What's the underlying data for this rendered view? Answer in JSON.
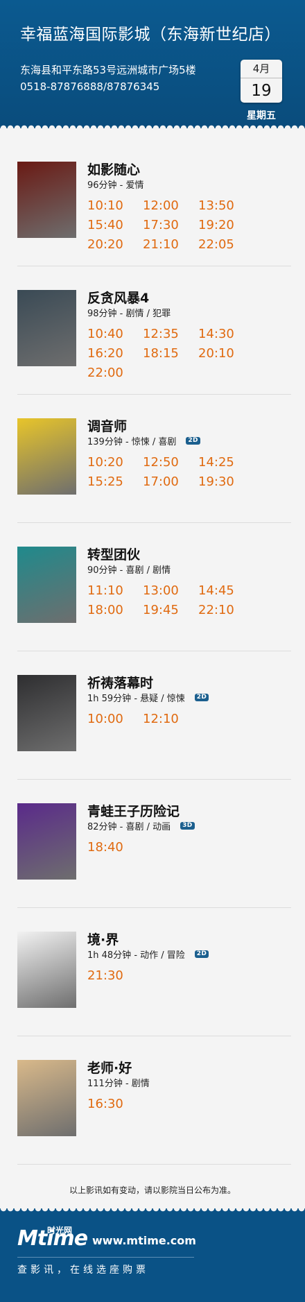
{
  "cinema": {
    "name": "幸福蓝海国际影城（东海新世纪店）",
    "address": "东海县和平东路53号远洲城市广场5楼",
    "phone": "0518-87876888/87876345",
    "date_month": "4月",
    "date_day": "19",
    "weekday": "星期五"
  },
  "movies": [
    {
      "title": "如影随心",
      "meta": "96分钟 - 爱情",
      "format": "",
      "poster_color": "#6a1a14",
      "times": [
        "10:10",
        "12:00",
        "13:50",
        "15:40",
        "17:30",
        "19:20",
        "20:20",
        "21:10",
        "22:05"
      ]
    },
    {
      "title": "反贪风暴4",
      "meta": "98分钟 - 剧情 / 犯罪",
      "format": "",
      "poster_color": "#3a4a55",
      "times": [
        "10:40",
        "12:35",
        "14:30",
        "16:20",
        "18:15",
        "20:10",
        "22:00"
      ]
    },
    {
      "title": "调音师",
      "meta": "139分钟 - 惊悚 / 喜剧",
      "format": "2D",
      "poster_color": "#e8c52a",
      "times": [
        "10:20",
        "12:50",
        "14:25",
        "15:25",
        "17:00",
        "19:30"
      ]
    },
    {
      "title": "转型团伙",
      "meta": "90分钟 - 喜剧 / 剧情",
      "format": "",
      "poster_color": "#1f8a8c",
      "times": [
        "11:10",
        "13:00",
        "14:45",
        "18:00",
        "19:45",
        "22:10"
      ]
    },
    {
      "title": "祈祷落幕时",
      "meta": "1h 59分钟 - 悬疑 / 惊悚",
      "format": "2D",
      "poster_color": "#2e2e30",
      "times": [
        "10:00",
        "12:10"
      ]
    },
    {
      "title": "青蛙王子历险记",
      "meta": "82分钟 - 喜剧 / 动画",
      "format": "3D",
      "poster_color": "#5a2a8a",
      "times": [
        "18:40"
      ]
    },
    {
      "title": "境·界",
      "meta": "1h 48分钟 - 动作 / 冒险",
      "format": "2D",
      "poster_color": "#f2f2f2",
      "times": [
        "21:30"
      ]
    },
    {
      "title": "老师·好",
      "meta": "111分钟 - 剧情",
      "format": "",
      "poster_color": "#d9b98a",
      "times": [
        "16:30"
      ]
    }
  ],
  "notice": "以上影讯如有变动，请以影院当日公布为准。",
  "footer": {
    "logo_text": "Mtime",
    "logo_cn": "时光网",
    "site": "www.mtime.com",
    "slogan": "查影讯，在线选座购票"
  },
  "colors": {
    "header_bg": "#0a4f80",
    "time_color": "#e06a10",
    "badge_bg": "#1b5f8e"
  }
}
